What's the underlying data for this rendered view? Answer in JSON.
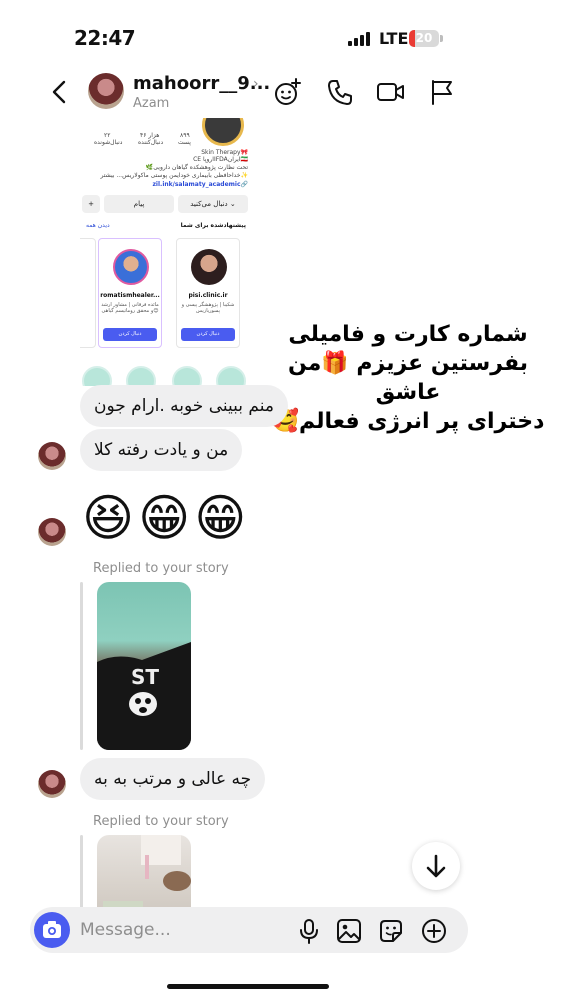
{
  "status_bar": {
    "time": "22:47",
    "network": "LTE",
    "battery_level": "20",
    "battery_fraction": 0.2
  },
  "header": {
    "username": "mahoorr__9...",
    "subtitle": "Azam",
    "icons": [
      "back-icon",
      "effects-icon",
      "phone-icon",
      "video-icon",
      "flag-icon"
    ]
  },
  "shared_post": {
    "stats": {
      "posts_count": "۸۹۹",
      "posts_label": "پست",
      "followers_count": "۴۶ هزار",
      "followers_label": "دنبال‌کننده",
      "following_count": "۲۲",
      "following_label": "دنبال‌شونده"
    },
    "bio_line_1": "Skin Therapy🎀",
    "bio_line_2": "CE اروپاIFDAایران🇮🇷",
    "bio_line_3": "تحت نظارت پژوهشکده گیاهان دارویی🌿",
    "bio_line_4": "✨خداحافظی بابیماری خودایمن پوستی ماکولاریس... بیشتر",
    "link": "zil.ink/salamaty_academic🔗",
    "follow_btn": "دنبال می‌کنید ⌄",
    "message_btn": "پیام",
    "suggested_label": "پیشنهادشده برای شما",
    "see_all": "دیدن همه",
    "cards": [
      {
        "name": "pisi.clinic.ir",
        "desc": "شکیبا | پژوهشگر پیسی و پسوریازیس",
        "button": "دنبال کردن"
      },
      {
        "name": "romatismhealer...",
        "desc": "مائده فرقانی | مشاور ارشد و محقق روماتیسم گیاهی😊",
        "button": "دنبال کردن"
      }
    ]
  },
  "overlay_caption": {
    "line_1": "شماره کارت و فامیلی",
    "line_2": "بفرستین عزیزم 🎁من عاشق",
    "line_3": "دخترای پر انرژی فعالم🥰"
  },
  "messages": [
    {
      "text": "منم ببینی خوبه .ارام جون"
    },
    {
      "text": "من و یادت رفته کلا"
    },
    {
      "text": "😆😁😁"
    },
    {
      "reply_label": "Replied to your story"
    },
    {
      "text": "چه عالی و مرتب به به"
    },
    {
      "reply_label": "Replied to your story"
    }
  ],
  "composer": {
    "placeholder": "Message...",
    "icons": [
      "camera-icon",
      "microphone-icon",
      "gallery-icon",
      "sticker-icon",
      "plus-icon"
    ]
  },
  "colors": {
    "accent": "#4a5cf0",
    "bubble": "#efeff0",
    "battery_low": "#ea3b34"
  }
}
